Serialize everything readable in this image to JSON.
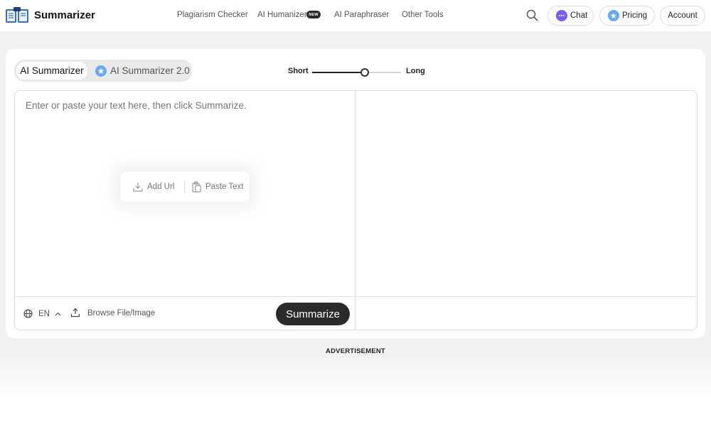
{
  "header": {
    "brand": "Summarizer",
    "nav": [
      {
        "label": "Plagiarism Checker"
      },
      {
        "label": "AI Humanizer",
        "badge": "NEW"
      },
      {
        "label": "AI Paraphraser"
      },
      {
        "label": "Other Tools"
      }
    ],
    "chat_label": "Chat",
    "pricing_label": "Pricing",
    "account_label": "Account"
  },
  "tabs": {
    "active": "AI Summarizer",
    "second": "AI Summarizer 2.0"
  },
  "length": {
    "short_label": "Short",
    "long_label": "Long",
    "value": 0.59
  },
  "editor": {
    "placeholder": "Enter or paste your text here, then click Summarize.",
    "add_url": "Add Url",
    "paste_text": "Paste Text"
  },
  "footer": {
    "language": "EN",
    "browse": "Browse File/Image",
    "summarize": "Summarize"
  },
  "ad_label": "ADVERTISEMENT",
  "colors": {
    "accent_dark": "#2b2b2b",
    "page_bg": "#f2f2f3",
    "chat_icon": "#7b5cf0",
    "pricing_icon": "#6aa7f5"
  },
  "icons": [
    "book-logo-icon",
    "search-icon",
    "chat-icon",
    "pricing-icon",
    "summarizer-2-icon",
    "add-url-icon",
    "paste-icon",
    "globe-icon",
    "chevron-up-icon",
    "upload-icon"
  ]
}
